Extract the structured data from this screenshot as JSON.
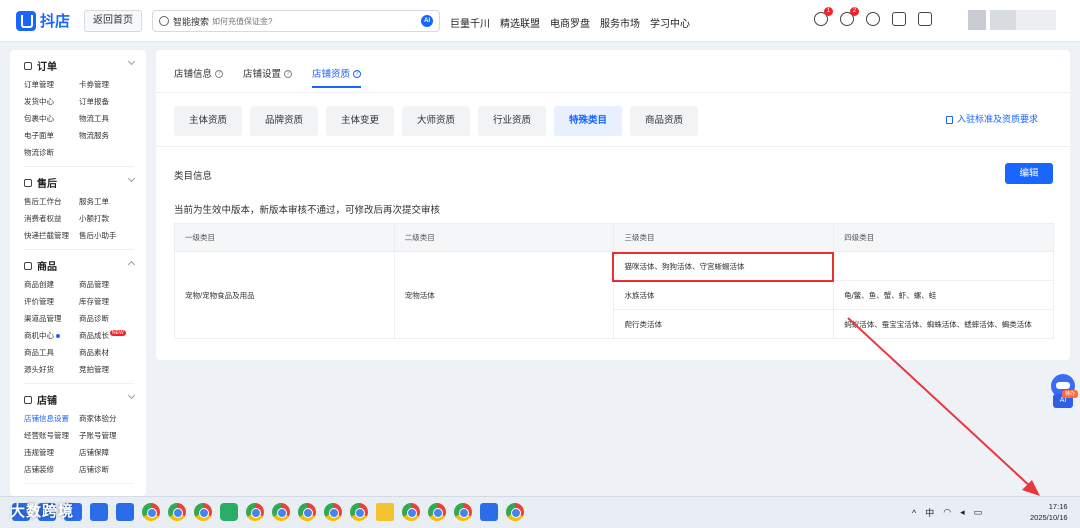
{
  "header": {
    "logo_text": "抖店",
    "home_button": "返回首页",
    "search_label": "智能搜索",
    "search_placeholder": "如何充值保证金?",
    "search_ai": "AI",
    "nav": [
      "巨量千川",
      "精选联盟",
      "电商罗盘",
      "服务市场",
      "学习中心"
    ],
    "bell_badge": "1",
    "user_badge": "2"
  },
  "sidebar": {
    "groups": [
      {
        "title": "订单",
        "items": [
          "订单管理",
          "卡券管理",
          "发货中心",
          "订单报备",
          "包裹中心",
          "物流工具",
          "电子面单",
          "物流服务",
          "物流诊断"
        ]
      },
      {
        "title": "售后",
        "items": [
          "售后工作台",
          "服务工单",
          "消费者权益",
          "小额打款",
          "快递拦截管理",
          "售后小助手"
        ]
      },
      {
        "title": "商品",
        "items": [
          "商品创建",
          "商品管理",
          "评价管理",
          "库存管理",
          "渠道品管理",
          "商品诊断",
          "商机中心",
          "商品成长",
          "商品工具",
          "商品素材",
          "源头好货",
          "竞拍管理"
        ],
        "new_badge": "NEW"
      },
      {
        "title": "店铺",
        "items": [
          "店铺信息设置",
          "商家体验分",
          "经营账号管理",
          "子账号管理",
          "违规管理",
          "店铺保障",
          "店铺装修",
          "店铺诊断"
        ]
      }
    ]
  },
  "main": {
    "tabs": [
      "店铺信息",
      "店铺设置",
      "店铺资质"
    ],
    "subtabs": [
      "主体资质",
      "品牌资质",
      "主体变更",
      "大师资质",
      "行业资质",
      "特殊类目",
      "商品资质"
    ],
    "req_link": "入驻标准及资质要求",
    "section_title": "类目信息",
    "edit_button": "编辑",
    "notice": "当前为生效中版本，新版本审核不通过，可修改后再次提交审核",
    "table": {
      "headers": [
        "一级类目",
        "二级类目",
        "三级类目",
        "四级类目"
      ],
      "level1": "宠物/宠物食品及用品",
      "level2": "宠物活体",
      "rows": [
        {
          "level3": "猫咪活体、狗狗活体、守宫蜥蜴活体",
          "level4": ""
        },
        {
          "level3": "水族活体",
          "level4": "龟/鳖、鱼、蟹、虾、螺、蛙"
        },
        {
          "level3": "爬行类活体",
          "level4": "蚂蚁活体、蚕宝宝活体、蜘蛛活体、蟋蟀活体、蝎类活体"
        }
      ]
    }
  },
  "widget": {
    "label": "AI",
    "tag": "待办"
  },
  "taskbar": {
    "watermark": "大数跨境",
    "tray": [
      "中"
    ],
    "time": "17:16",
    "date": "2025/10/16"
  }
}
